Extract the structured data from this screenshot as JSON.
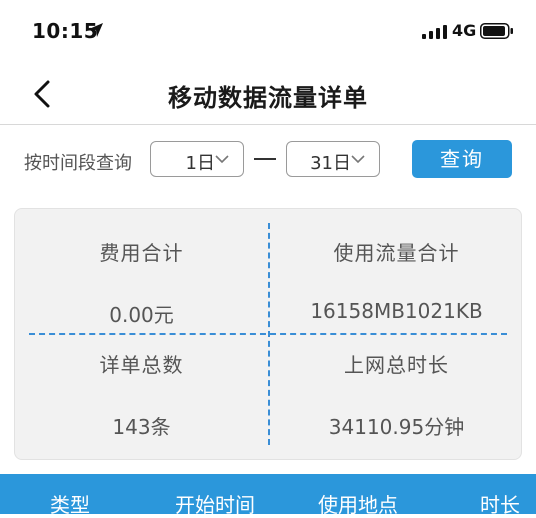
{
  "status_bar": {
    "time": "10:15",
    "network": "4G"
  },
  "nav": {
    "title": "移动数据流量详单"
  },
  "query": {
    "label": "按时间段查询",
    "start": "1日",
    "end": "31日",
    "button": "查询"
  },
  "summary": {
    "fee_label": "费用合计",
    "fee_value": "0.00元",
    "usage_label": "使用流量合计",
    "usage_value": "16158MB1021KB",
    "count_label": "详单总数",
    "count_value": "143条",
    "duration_label": "上网总时长",
    "duration_value": "34110.95分钟"
  },
  "table": {
    "columns": [
      "类型",
      "开始时间",
      "使用地点",
      "时长"
    ]
  },
  "colors": {
    "accent": "#2b97db",
    "divider": "#3a8ed6"
  },
  "icons": [
    "location-arrow-icon",
    "signal-icon",
    "battery-icon",
    "back-chevron-icon",
    "chevron-down-icon"
  ]
}
